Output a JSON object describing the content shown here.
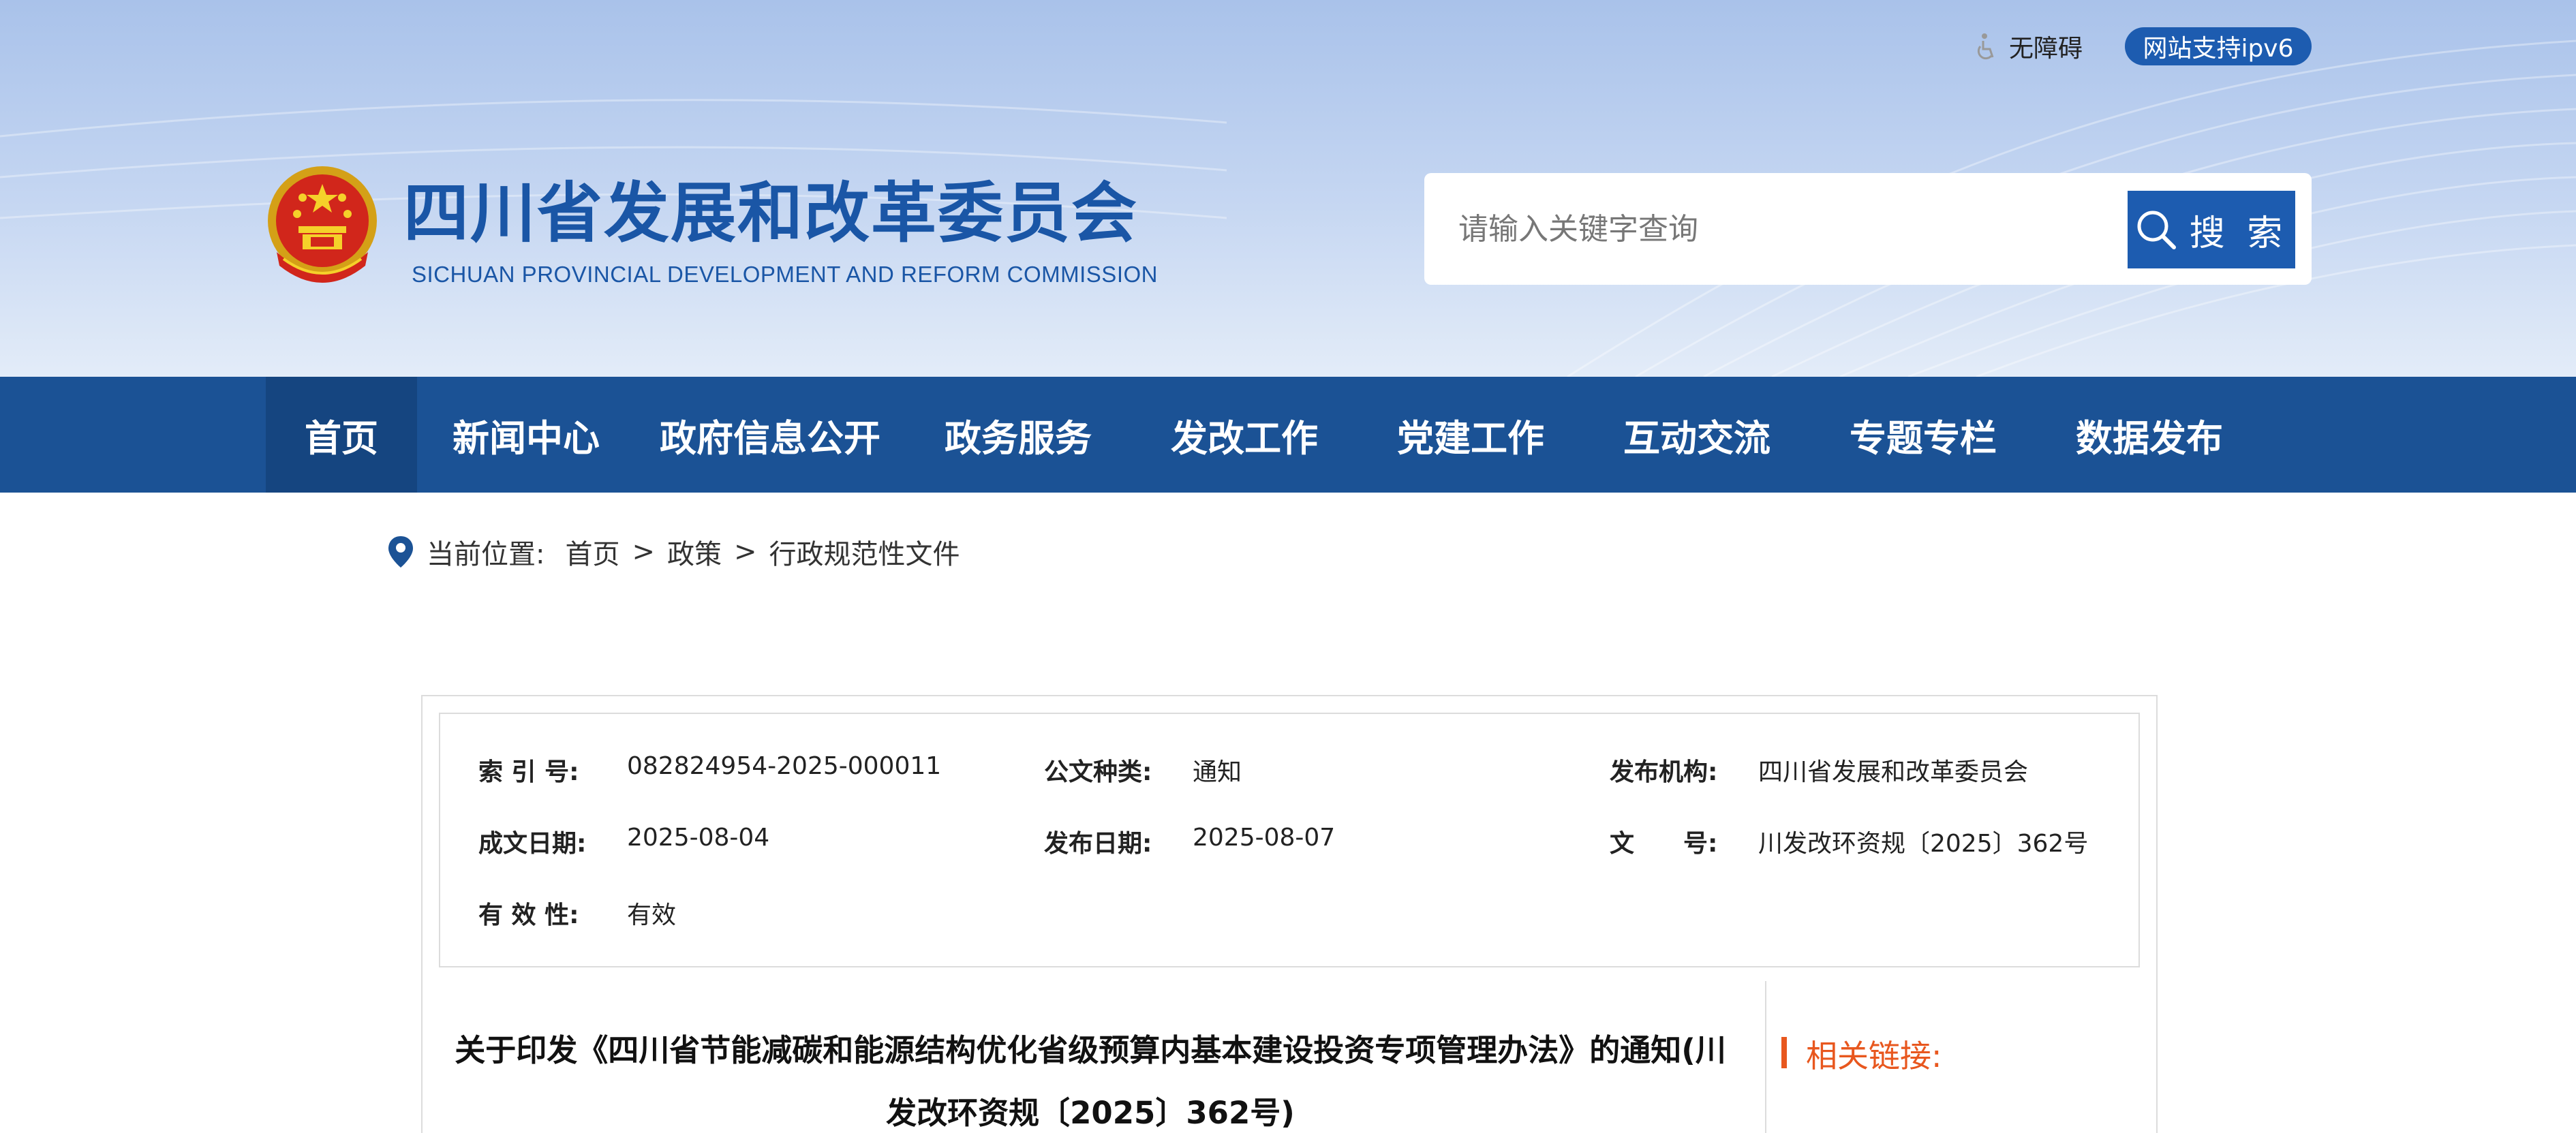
{
  "header": {
    "accessibility_label": "无障碍",
    "ipv6_label": "网站支持ipv6",
    "title": "四川省发展和改革委员会",
    "subtitle": "SICHUAN PROVINCIAL DEVELOPMENT AND REFORM COMMISSION",
    "search": {
      "placeholder": "请输入关键字查询",
      "button_label": "搜 索"
    }
  },
  "nav": {
    "items": [
      {
        "label": "首页",
        "active": true
      },
      {
        "label": "新闻中心"
      },
      {
        "label": "政府信息公开"
      },
      {
        "label": "政务服务"
      },
      {
        "label": "发改工作"
      },
      {
        "label": "党建工作"
      },
      {
        "label": "互动交流"
      },
      {
        "label": "专题专栏"
      },
      {
        "label": "数据发布"
      }
    ]
  },
  "breadcrumb": {
    "label": "当前位置:",
    "items": [
      "首页",
      "政策",
      "行政规范性文件"
    ],
    "separator": ">"
  },
  "meta": {
    "index_no": {
      "label": "索 引 号:",
      "value": "082824954-2025-000011"
    },
    "doc_type": {
      "label": "公文种类:",
      "value": "通知"
    },
    "issuer": {
      "label": "发布机构:",
      "value": "四川省发展和改革委员会"
    },
    "written_date": {
      "label": "成文日期:",
      "value": "2025-08-04"
    },
    "publish_date": {
      "label": "发布日期:",
      "value": "2025-08-07"
    },
    "doc_number": {
      "label": "文　　号:",
      "value": "川发改环资规〔2025〕362号"
    },
    "validity": {
      "label": "有 效 性:",
      "value": "有效"
    }
  },
  "article": {
    "title_line1": "关于印发《四川省节能减碳和能源结构优化省级预算内基本建设投资专项管理办法》的通知(川",
    "title_line2": "发改环资规〔2025〕362号)"
  },
  "sidebar": {
    "related_title": "相关链接:"
  },
  "colors": {
    "brand_blue": "#1b5295",
    "accent_orange": "#e8571e",
    "button_blue": "#1d5cb0"
  }
}
